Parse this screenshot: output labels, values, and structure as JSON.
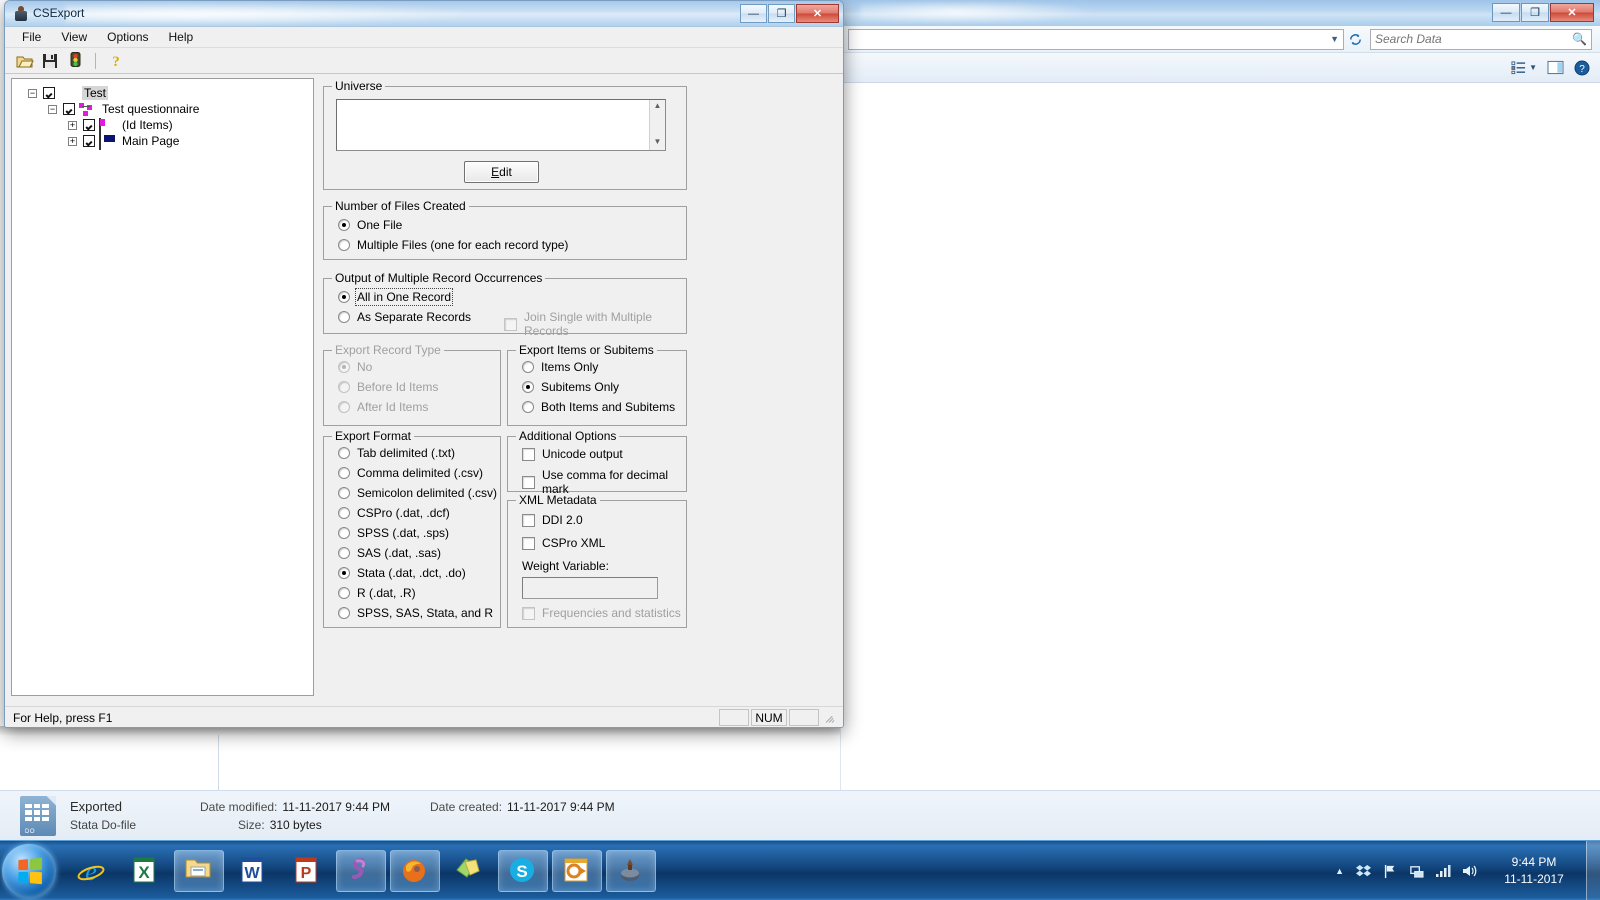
{
  "explorer": {
    "search_placeholder": "Search Data",
    "address_value": "",
    "window_buttons": {
      "minimize": "—",
      "maximize": "❐",
      "close": "✕"
    },
    "toolbar_icons": [
      "views-icon",
      "chevron-down-icon",
      "preview-pane-icon",
      "help-icon"
    ]
  },
  "details_pane": {
    "file_name": "Exported",
    "file_type": "Stata Do-file",
    "date_modified_label": "Date modified:",
    "date_modified_value": "11-11-2017 9:44 PM",
    "date_created_label": "Date created:",
    "date_created_value": "11-11-2017 9:44 PM",
    "size_label": "Size:",
    "size_value": "310 bytes",
    "icon_tag": "DO"
  },
  "taskbar": {
    "start_label": "start-orb",
    "items": [
      {
        "name": "internet-explorer",
        "pinned": true
      },
      {
        "name": "excel",
        "pinned": true
      },
      {
        "name": "windows-explorer",
        "pinned": true,
        "active": true
      },
      {
        "name": "word",
        "pinned": true
      },
      {
        "name": "powerpoint",
        "pinned": true
      },
      {
        "name": "spss",
        "pinned": true,
        "active": true
      },
      {
        "name": "firefox",
        "pinned": true,
        "active": true
      },
      {
        "name": "sticky-notes",
        "pinned": true
      },
      {
        "name": "skype",
        "pinned": true,
        "active": true
      },
      {
        "name": "outlook",
        "pinned": true,
        "active": true
      },
      {
        "name": "cspro",
        "pinned": true,
        "active": true
      }
    ],
    "tray": [
      "show-hidden-icons",
      "dropbox",
      "action-center-flag",
      "network",
      "signal",
      "volume"
    ],
    "clock_time": "9:44 PM",
    "clock_date": "11-11-2017"
  },
  "csexport": {
    "title": "CSExport",
    "window_buttons": {
      "minimize": "—",
      "maximize": "❐",
      "close": "✕"
    },
    "menu": [
      "File",
      "View",
      "Options",
      "Help"
    ],
    "toolbar": [
      "open-icon",
      "save-icon",
      "run-export-icon",
      "help-icon"
    ],
    "tree": [
      {
        "level": 0,
        "expander": "−",
        "checked": true,
        "icon": "dictionary-icon",
        "label": "Test",
        "selected": true
      },
      {
        "level": 1,
        "expander": "−",
        "checked": true,
        "icon": "questionnaire-icon",
        "label": "Test questionnaire",
        "selected": false
      },
      {
        "level": 2,
        "expander": "+",
        "checked": true,
        "icon": "id-items-icon",
        "label": "(Id Items)",
        "selected": false
      },
      {
        "level": 2,
        "expander": "+",
        "checked": true,
        "icon": "record-icon",
        "label": "Main Page",
        "selected": false
      }
    ],
    "universe": {
      "legend": "Universe",
      "value": "",
      "edit_button": "Edit",
      "edit_accel": "E"
    },
    "number_of_files": {
      "legend": "Number of Files Created",
      "options": [
        {
          "label": "One File",
          "selected": true,
          "disabled": false
        },
        {
          "label": "Multiple Files (one for each record type)",
          "selected": false,
          "disabled": false
        }
      ]
    },
    "multiple_record_occurrences": {
      "legend": "Output of Multiple Record Occurrences",
      "options": [
        {
          "label": "All in One Record",
          "selected": true,
          "disabled": false,
          "focused": true
        },
        {
          "label": "As Separate Records",
          "selected": false,
          "disabled": false,
          "focused": false
        }
      ],
      "join_checkbox": {
        "label": "Join Single with Multiple Records",
        "checked": false,
        "disabled": true
      }
    },
    "export_record_type": {
      "legend": "Export Record Type",
      "disabled": true,
      "options": [
        {
          "label": "No",
          "selected": true,
          "disabled": true
        },
        {
          "label": "Before Id Items",
          "selected": false,
          "disabled": true
        },
        {
          "label": "After Id Items",
          "selected": false,
          "disabled": true
        }
      ]
    },
    "export_items_or_subitems": {
      "legend": "Export Items or Subitems",
      "options": [
        {
          "label": "Items Only",
          "selected": false,
          "disabled": false
        },
        {
          "label": "Subitems Only",
          "selected": true,
          "disabled": false
        },
        {
          "label": "Both Items and Subitems",
          "selected": false,
          "disabled": false
        }
      ]
    },
    "export_format": {
      "legend": "Export Format",
      "options": [
        {
          "label": "Tab delimited (.txt)",
          "selected": false
        },
        {
          "label": "Comma delimited (.csv)",
          "selected": false
        },
        {
          "label": "Semicolon delimited (.csv)",
          "selected": false
        },
        {
          "label": "CSPro (.dat, .dcf)",
          "selected": false
        },
        {
          "label": "SPSS (.dat, .sps)",
          "selected": false
        },
        {
          "label": "SAS (.dat, .sas)",
          "selected": false
        },
        {
          "label": "Stata (.dat, .dct, .do)",
          "selected": true
        },
        {
          "label": "R (.dat, .R)",
          "selected": false
        },
        {
          "label": "SPSS, SAS, Stata, and R",
          "selected": false
        }
      ]
    },
    "additional_options": {
      "legend": "Additional Options",
      "options": [
        {
          "label": "Unicode output",
          "checked": false,
          "disabled": false
        },
        {
          "label": "Use comma for decimal mark",
          "checked": false,
          "disabled": false
        }
      ]
    },
    "xml_metadata": {
      "legend": "XML Metadata",
      "options": [
        {
          "label": "DDI 2.0",
          "checked": false,
          "disabled": false
        },
        {
          "label": "CSPro XML",
          "checked": false,
          "disabled": false
        }
      ],
      "weight_label": "Weight Variable:",
      "weight_value": "",
      "frequencies": {
        "label": "Frequencies and statistics",
        "checked": false,
        "disabled": true
      }
    },
    "statusbar": {
      "hint": "For Help, press F1",
      "indicator_num": "NUM"
    }
  },
  "colors": {
    "accent": "#2a70b5",
    "dialog_bg": "#f0f0f0",
    "disabled_text": "#a0a0a0",
    "close_red": "#cd4a38"
  }
}
